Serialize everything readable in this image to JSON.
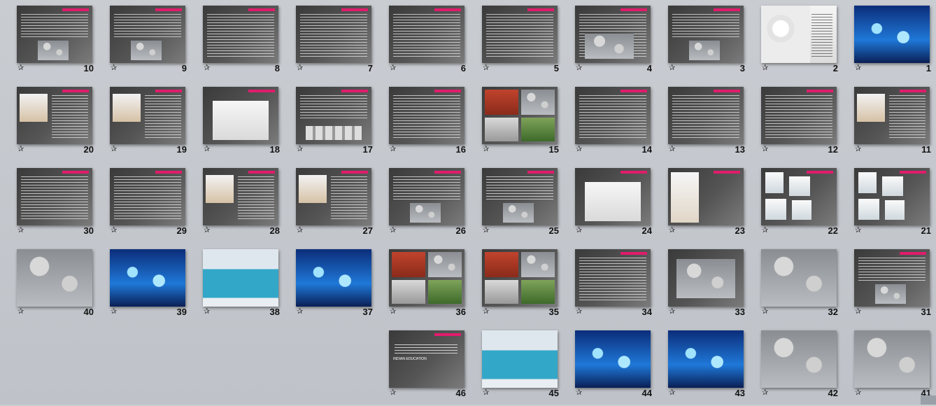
{
  "slides": [
    {
      "n": "1",
      "style": "photo-blue"
    },
    {
      "n": "2",
      "style": "light-bubbles"
    },
    {
      "n": "3",
      "style": "text-photo"
    },
    {
      "n": "4",
      "style": "text-photo-wide"
    },
    {
      "n": "5",
      "style": "text"
    },
    {
      "n": "6",
      "style": "text"
    },
    {
      "n": "7",
      "style": "text"
    },
    {
      "n": "8",
      "style": "text"
    },
    {
      "n": "9",
      "style": "text-photo"
    },
    {
      "n": "10",
      "style": "text-photo"
    },
    {
      "n": "11",
      "style": "text-photo-left"
    },
    {
      "n": "12",
      "style": "text"
    },
    {
      "n": "13",
      "style": "text"
    },
    {
      "n": "14",
      "style": "text"
    },
    {
      "n": "15",
      "style": "collage"
    },
    {
      "n": "16",
      "style": "text"
    },
    {
      "n": "17",
      "style": "text-strip"
    },
    {
      "n": "18",
      "style": "diagram"
    },
    {
      "n": "19",
      "style": "text-photo-left"
    },
    {
      "n": "20",
      "style": "text-photo-left"
    },
    {
      "n": "21",
      "style": "windows"
    },
    {
      "n": "22",
      "style": "windows"
    },
    {
      "n": "23",
      "style": "diagram-left"
    },
    {
      "n": "24",
      "style": "diagram"
    },
    {
      "n": "25",
      "style": "text-photo"
    },
    {
      "n": "26",
      "style": "text-photo"
    },
    {
      "n": "27",
      "style": "text-photo-left"
    },
    {
      "n": "28",
      "style": "text-photo-left"
    },
    {
      "n": "29",
      "style": "text"
    },
    {
      "n": "30",
      "style": "text"
    },
    {
      "n": "31",
      "style": "text-photo"
    },
    {
      "n": "32",
      "style": "photo-grey"
    },
    {
      "n": "33",
      "style": "photo-roof"
    },
    {
      "n": "34",
      "style": "text"
    },
    {
      "n": "35",
      "style": "collage"
    },
    {
      "n": "36",
      "style": "collage"
    },
    {
      "n": "37",
      "style": "photo-blue"
    },
    {
      "n": "38",
      "style": "photo-pool"
    },
    {
      "n": "39",
      "style": "photo-blue"
    },
    {
      "n": "40",
      "style": "photo-grey"
    },
    {
      "n": "41",
      "style": "photo-grey"
    },
    {
      "n": "42",
      "style": "photo-grey"
    },
    {
      "n": "43",
      "style": "photo-blue"
    },
    {
      "n": "44",
      "style": "photo-blue"
    },
    {
      "n": "45",
      "style": "photo-pool"
    },
    {
      "n": "46",
      "style": "text-end"
    }
  ],
  "star_glyph": "✰",
  "colors": {
    "accent": "#e01c6c",
    "blue": "#1e6fd1",
    "cyan": "#4fc6e8"
  },
  "end_slide_url": "INDIAN-EDUCATION"
}
